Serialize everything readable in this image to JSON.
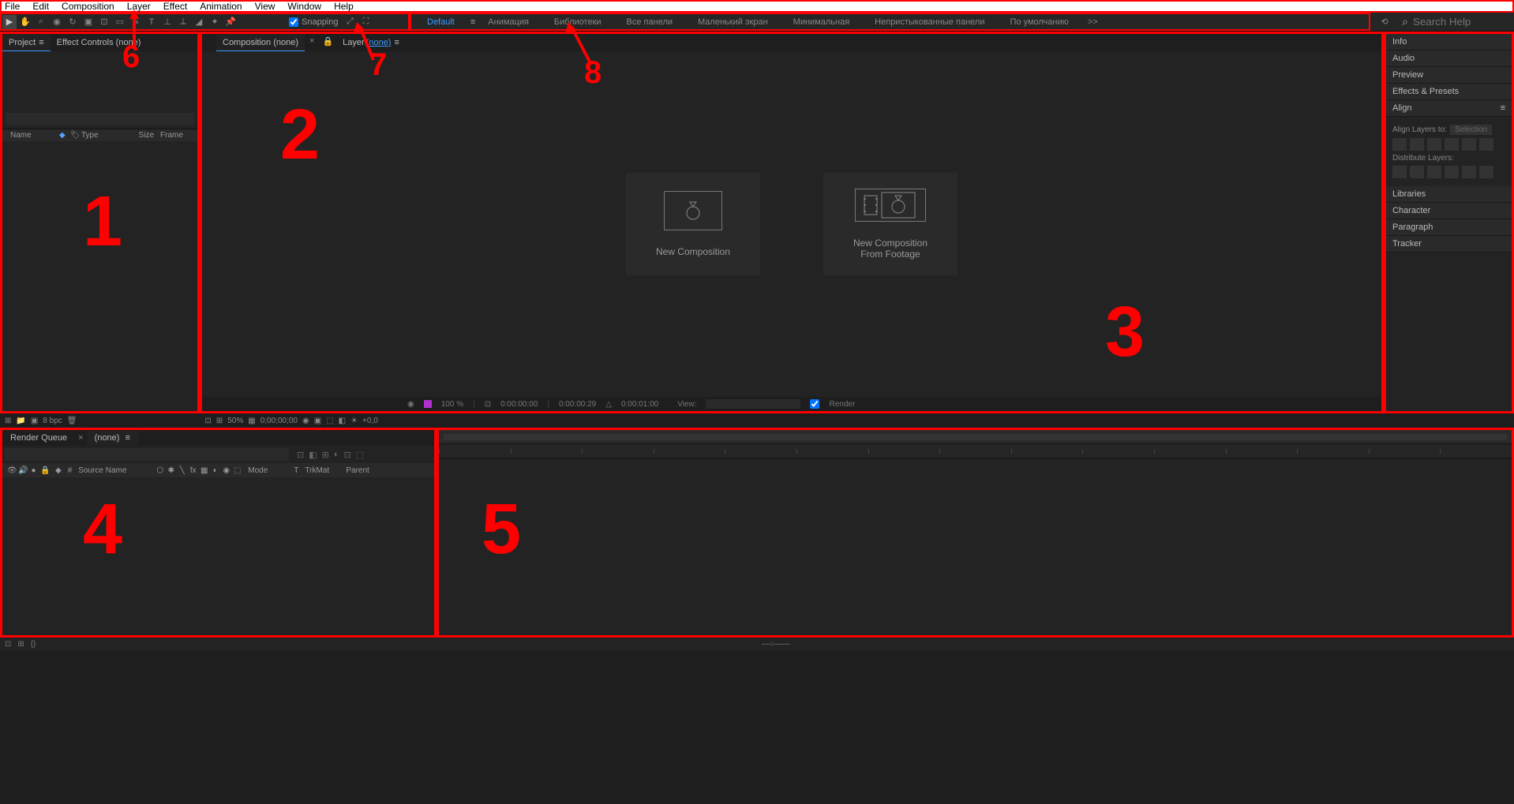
{
  "menu": [
    "File",
    "Edit",
    "Composition",
    "Layer",
    "Effect",
    "Animation",
    "View",
    "Window",
    "Help"
  ],
  "toolbar": {
    "snapping_label": "Snapping"
  },
  "workspaces": {
    "items": [
      "Default",
      "Анимация",
      "Библиотеки",
      "Все панели",
      "Маленький экран",
      "Минимальная",
      "Непристыкованные панели",
      "По умолчанию"
    ],
    "more": ">>",
    "active_index": 0
  },
  "search": {
    "placeholder": "Search Help"
  },
  "project": {
    "tabs": {
      "project": "Project",
      "effect_controls": "Effect Controls (none)"
    },
    "search_placeholder": "",
    "headers": {
      "name": "Name",
      "type": "Type",
      "size": "Size",
      "frame": "Frame"
    },
    "footer": {
      "bpc": "8 bpc"
    }
  },
  "comp": {
    "tabs": {
      "composition": "Composition (none)",
      "layer": "Layer",
      "layer_link": "(none)"
    },
    "actions": {
      "new_comp": "New Composition",
      "from_footage": "New Composition\nFrom Footage"
    },
    "footer": {
      "zoom": "100 %",
      "t1": "0:00:00:00",
      "t2": "0:00:00:29",
      "t3": "0:00:01:00",
      "view_label": "View:",
      "render_label": "Render"
    }
  },
  "midbar": {
    "zoom": "50%",
    "time": "0;00;00;00",
    "offset": "+0,0"
  },
  "right": {
    "panels": [
      "Info",
      "Audio",
      "Preview",
      "Effects & Presets",
      "Align",
      "Libraries",
      "Character",
      "Paragraph",
      "Tracker"
    ],
    "align": {
      "labelto": "Align Layers to:",
      "selection": "Selection",
      "distribute": "Distribute Layers:"
    }
  },
  "timeline": {
    "tabs": {
      "render_queue": "Render Queue",
      "none": "(none)"
    },
    "search_placeholder": "",
    "headers": {
      "hash": "#",
      "source_name": "Source Name",
      "mode": "Mode",
      "t": "T",
      "trkmat": "TrkMat",
      "parent": "Parent"
    }
  },
  "annotations": {
    "n1": "1",
    "n2": "2",
    "n3": "3",
    "n4": "4",
    "n5": "5",
    "n6": "6",
    "n7": "7",
    "n8": "8"
  }
}
